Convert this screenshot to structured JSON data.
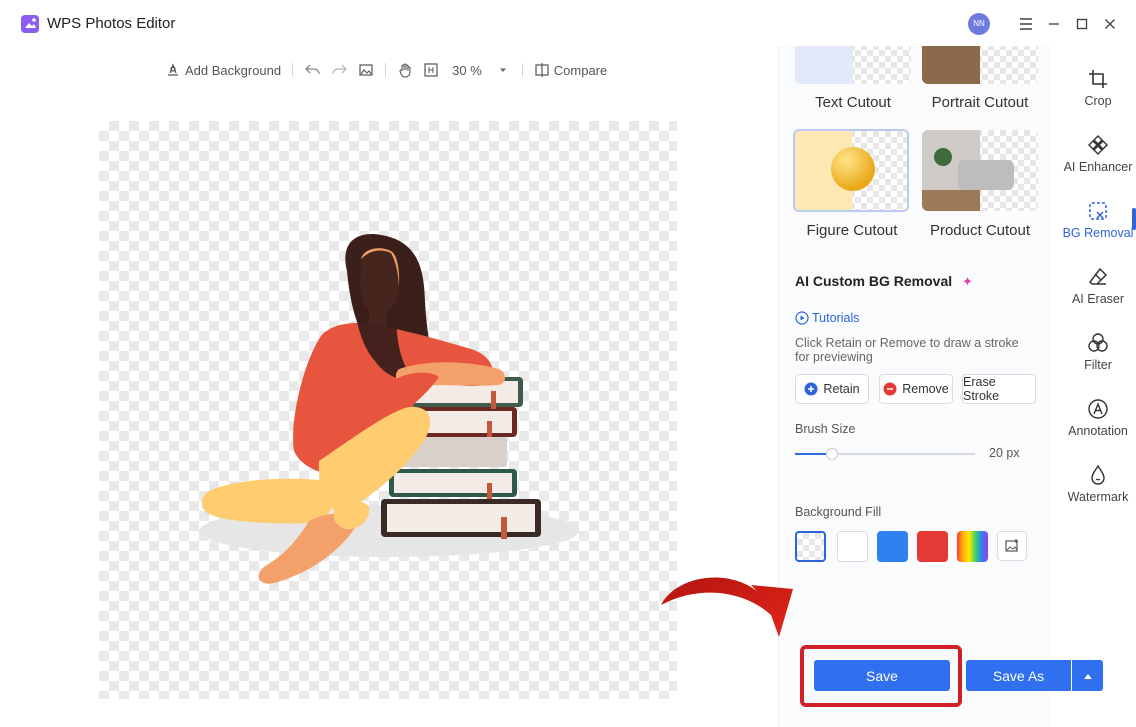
{
  "app": {
    "title": "WPS Photos Editor",
    "avatar_initials": "NN"
  },
  "toolbar": {
    "add_background": "Add Background",
    "zoom": "30 %",
    "compare": "Compare"
  },
  "panel": {
    "cutouts": [
      {
        "label": "Text Cutout"
      },
      {
        "label": "Portrait Cutout"
      },
      {
        "label": "Figure Cutout"
      },
      {
        "label": "Product Cutout"
      }
    ],
    "section_title": "AI Custom BG Removal",
    "tutorials": "Tutorials",
    "hint": "Click Retain or Remove to draw a stroke for previewing",
    "retain": "Retain",
    "remove": "Remove",
    "erase_stroke": "Erase Stroke",
    "brush_size_label": "Brush Size",
    "brush_size_value": "20 px",
    "brush_size": 20,
    "background_fill_label": "Background Fill",
    "fill_colors": [
      "transparent",
      "#ffffff",
      "#2f80f0",
      "#e53935",
      "rainbow"
    ]
  },
  "rail": {
    "items": [
      {
        "label": "Crop",
        "icon": "crop-icon"
      },
      {
        "label": "AI Enhancer",
        "icon": "ai-enhancer-icon"
      },
      {
        "label": "BG Removal",
        "icon": "bg-removal-icon",
        "active": true
      },
      {
        "label": "AI Eraser",
        "icon": "eraser-icon"
      },
      {
        "label": "Filter",
        "icon": "filter-icon"
      },
      {
        "label": "Annotation",
        "icon": "annotation-icon"
      },
      {
        "label": "Watermark",
        "icon": "watermark-icon"
      }
    ]
  },
  "actions": {
    "save": "Save",
    "save_as": "Save As"
  },
  "colors": {
    "accent": "#2f6ff0",
    "highlight": "#d21f25"
  }
}
